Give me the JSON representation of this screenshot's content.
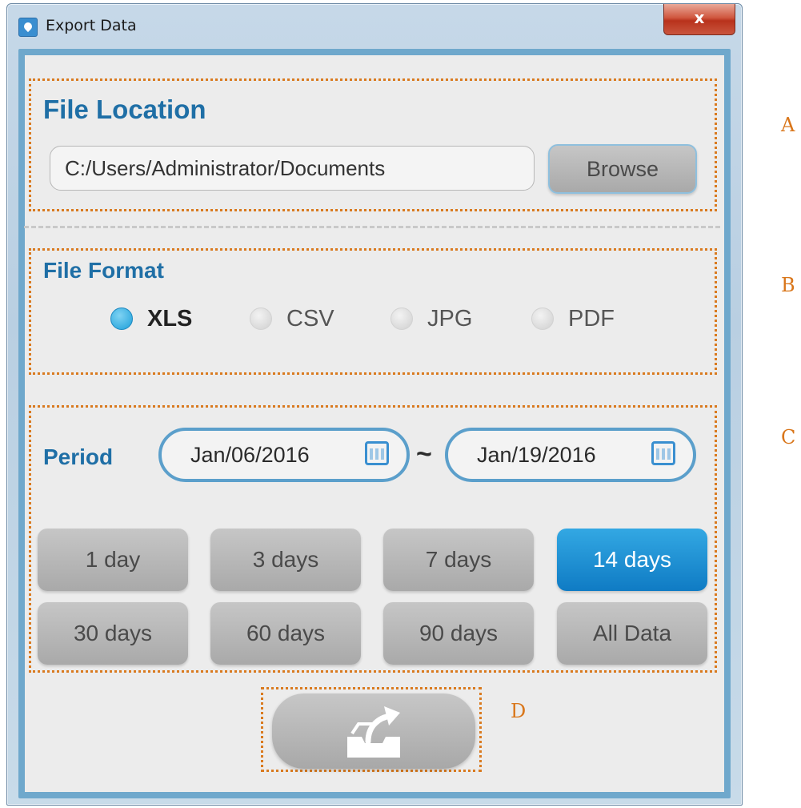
{
  "window": {
    "title": "Export Data",
    "close_label": "x"
  },
  "file_location": {
    "heading": "File Location",
    "path": "C:/Users/Administrator/Documents",
    "browse_label": "Browse"
  },
  "file_format": {
    "heading": "File Format",
    "options": [
      {
        "label": "XLS",
        "selected": true
      },
      {
        "label": "CSV",
        "selected": false
      },
      {
        "label": "JPG",
        "selected": false
      },
      {
        "label": "PDF",
        "selected": false
      }
    ]
  },
  "period": {
    "heading": "Period",
    "start_date": "Jan/06/2016",
    "separator": "~",
    "end_date": "Jan/19/2016",
    "ranges": [
      {
        "label": "1 day",
        "active": false
      },
      {
        "label": "3 days",
        "active": false
      },
      {
        "label": "7 days",
        "active": false
      },
      {
        "label": "14 days",
        "active": true
      },
      {
        "label": "30 days",
        "active": false
      },
      {
        "label": "60 days",
        "active": false
      },
      {
        "label": "90 days",
        "active": false
      },
      {
        "label": "All Data",
        "active": false
      }
    ]
  },
  "export": {
    "icon": "export-tray-icon"
  },
  "callouts": [
    "A",
    "B",
    "C",
    "D"
  ],
  "colors": {
    "accent": "#1f6fa6",
    "active_button": "#1a8fd4",
    "callout_border": "#d97a1f",
    "radio_selected": "#1d9fd9"
  }
}
